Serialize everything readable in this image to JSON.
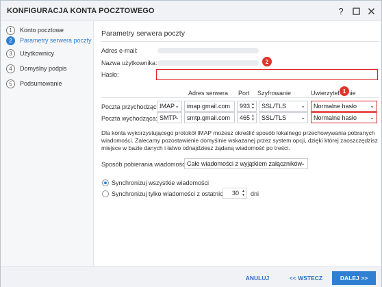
{
  "window": {
    "title": "KONFIGURACJA KONTA POCZTOWEGO",
    "help_icon": "help-icon",
    "maximize_icon": "maximize-icon",
    "close_icon": "close-icon"
  },
  "sidebar": {
    "steps": [
      {
        "num": "1",
        "label": "Konto pocztowe",
        "active": false
      },
      {
        "num": "2",
        "label": "Parametry serwera poczty",
        "active": true
      },
      {
        "num": "3",
        "label": "Użytkownicy",
        "active": false
      },
      {
        "num": "4",
        "label": "Domyślny podpis",
        "active": false
      },
      {
        "num": "5",
        "label": "Podsumowanie",
        "active": false
      }
    ]
  },
  "main": {
    "section_title": "Parametry serwera poczty",
    "email_label": "Adres e-mail:",
    "username_label": "Nazwa użytkownika:",
    "password_label": "Hasło:",
    "password_value": "",
    "badges": {
      "username": "2",
      "auth": "1"
    },
    "columns": {
      "server": "Adres serwera",
      "port": "Port",
      "encryption": "Szyfrowanie",
      "auth": "Uwierzytelnianie"
    },
    "incoming": {
      "label": "Poczta przychodząca:",
      "protocol": "IMAP",
      "server": "imap.gmail.com",
      "port": "993",
      "encryption": "SSL/TLS",
      "auth": "Normalne hasło"
    },
    "outgoing": {
      "label": "Poczta wychodząca:",
      "protocol": "SMTP",
      "server": "smtp.gmail.com",
      "port": "465",
      "encryption": "SSL/TLS",
      "auth": "Normalne hasło"
    },
    "info_text": "Dla konta wykorzystującego protokół IMAP możesz określić sposób lokalnego przechowywania pobranych wiadomości. Zalecamy pozostawienie domyślnie wskazanej przez system opcji, dzięki której zaoszczędzisz miejsce w bazie danych i łatwo odnajdziesz żądaną wiadomość po treści.",
    "fetch_label": "Sposób pobierania wiadomości:",
    "fetch_value": "Całe wiadomości z wyjątkiem załączników",
    "sync_all_label": "Synchronizuj wszystkie wiadomości",
    "sync_recent_label": "Synchronizuj tylko wiadomości z ostatnich",
    "sync_days_value": "30",
    "sync_days_unit": "dni",
    "sync_all_selected": true
  },
  "footer": {
    "cancel": "ANULUJ",
    "back": "<< WSTECZ",
    "next": "DALEJ >>"
  },
  "colors": {
    "accent": "#2f7fd3",
    "highlight": "#e02020",
    "badge": "#e0342a"
  }
}
